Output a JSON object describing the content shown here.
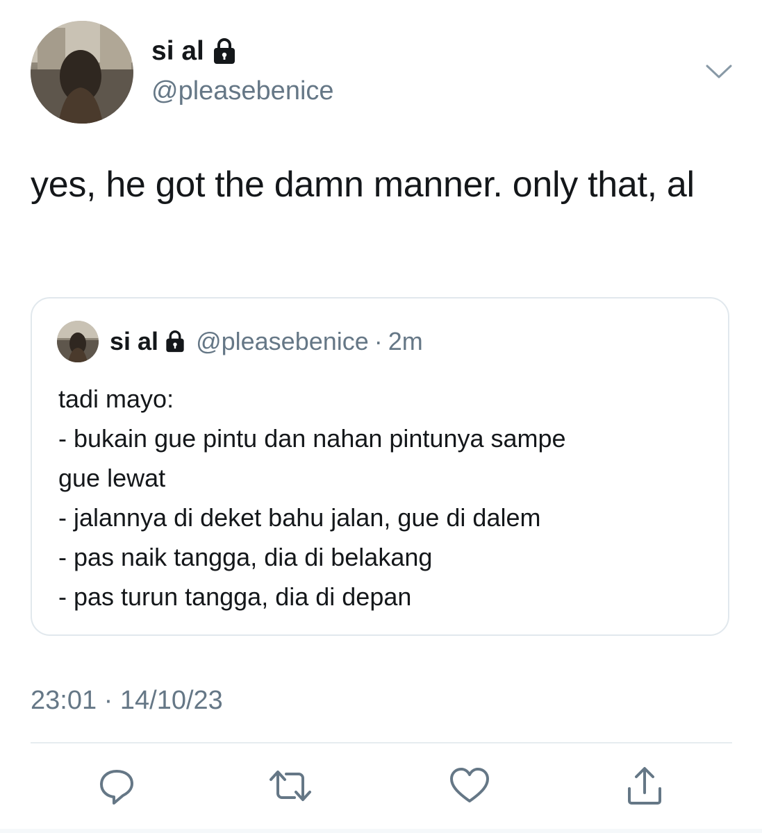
{
  "tweet": {
    "display_name": "si al",
    "handle": "@pleasebenice",
    "text": "yes, he got the damn manner. only that, al",
    "timestamp": "23:01 · 14/10/23"
  },
  "quoted_tweet": {
    "display_name": "si al",
    "handle": "@pleasebenice",
    "separator": "·",
    "time": "2m",
    "lines": [
      "tadi mayo:",
      "- bukain gue pintu dan nahan pintunya sampe",
      "gue lewat",
      "- jalannya di deket bahu jalan, gue di dalem",
      "- pas naik tangga, dia di belakang",
      "- pas turun tangga, dia di depan"
    ]
  },
  "icons": {
    "lock": "lock-icon",
    "menu": "chevron-down-icon",
    "reply": "reply-icon",
    "retweet": "retweet-icon",
    "like": "heart-icon",
    "share": "share-icon"
  },
  "colors": {
    "text": "#14171a",
    "secondary": "#657786",
    "border": "#e1e8ed"
  }
}
